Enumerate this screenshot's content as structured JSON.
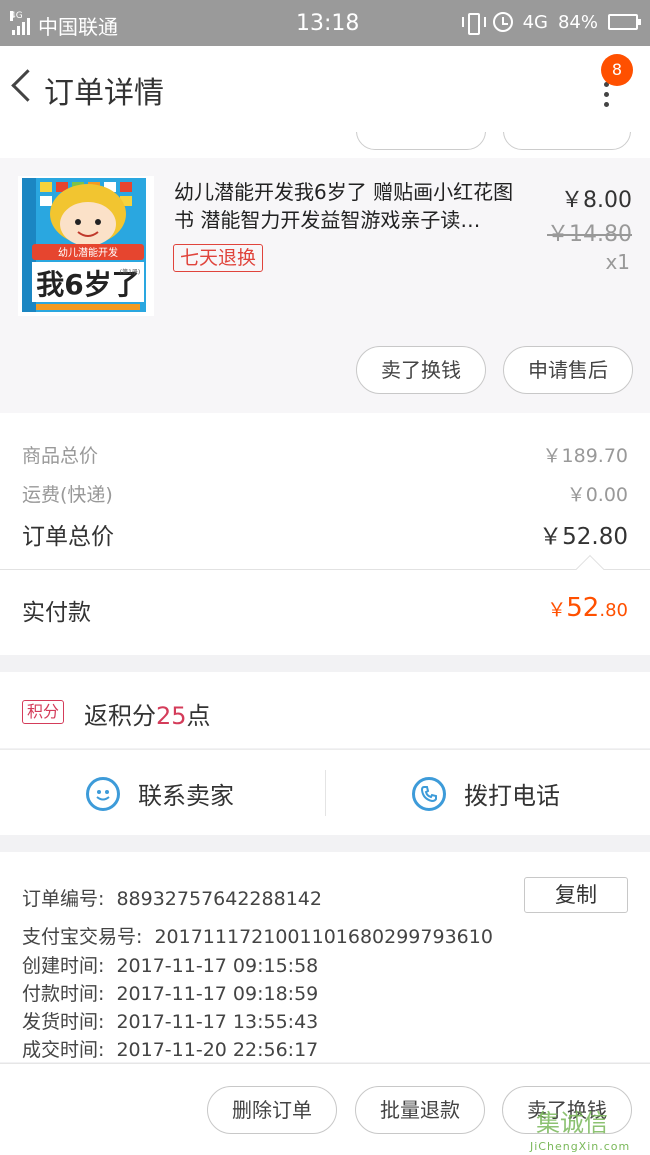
{
  "status_bar": {
    "network_type": "4G",
    "carrier": "中国联通",
    "time": "13:18",
    "data_type": "4G",
    "battery_percent": "84%",
    "battery_level": 0.84
  },
  "nav": {
    "title": "订单详情",
    "badge_count": "8",
    "back_icon": "chevron-left-icon",
    "more_icon": "more-vertical-icon"
  },
  "item": {
    "name": "幼儿潜能开发我6岁了 赠贴画小红花图书 潜能智力开发益智游戏亲子读…",
    "tag": "七天退换",
    "price": "￥8.00",
    "original_price": "￥14.80",
    "quantity": "x1",
    "thumb_cover_title": "我6岁了",
    "thumb_cover_banner": "幼儿潜能开发",
    "thumb_cover_label": "(第1册)",
    "buttons": {
      "sell": "卖了换钱",
      "after_sale": "申请售后"
    }
  },
  "totals": {
    "goods_label": "商品总价",
    "goods_value": "￥189.70",
    "shipping_label": "运费(快递)",
    "shipping_value": "￥0.00",
    "order_label": "订单总价",
    "order_value": "￥52.80",
    "paid_label": "实付款",
    "paid_currency": "￥",
    "paid_integer": "52",
    "paid_decimal": ".80"
  },
  "points": {
    "badge": "积分",
    "prefix": "返积分",
    "value": "25",
    "suffix": "点"
  },
  "contact": {
    "seller_label": "联系卖家",
    "seller_icon": "chat-smile-icon",
    "phone_label": "拨打电话",
    "phone_icon": "phone-icon"
  },
  "order_info": {
    "order_no_label": "订单编号:",
    "order_no": "88932757642288142",
    "copy_label": "复制",
    "alipay_label": "支付宝交易号:",
    "alipay_no": "2017111721001101680299793610",
    "created_label": "创建时间:",
    "created": "2017-11-17 09:15:58",
    "paid_label": "付款时间:",
    "paid": "2017-11-17 09:18:59",
    "shipped_label": "发货时间:",
    "shipped": "2017-11-17 13:55:43",
    "done_label": "成交时间:",
    "done": "2017-11-20 22:56:17"
  },
  "bottom_actions": {
    "delete": "删除订单",
    "batch_refund": "批量退款",
    "sell": "卖了换钱"
  },
  "watermark": {
    "main": "集诚信",
    "sub": "JiChengXin.com"
  },
  "colors": {
    "accent": "#ff5000",
    "link_blue": "#3d9bd9",
    "points_pink": "#d43c5a",
    "tag_red": "#e0443c"
  }
}
